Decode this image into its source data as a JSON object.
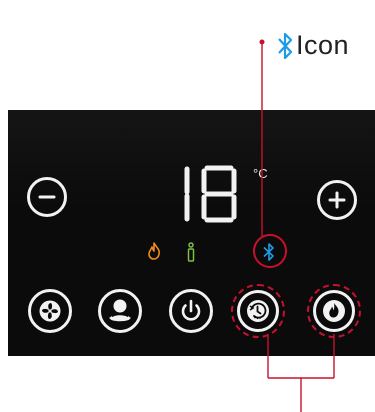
{
  "callout": {
    "label": "Icon",
    "icon": "bluetooth-icon",
    "accent": "#1e9be8"
  },
  "display": {
    "temperature": "18",
    "unit": "°C"
  },
  "controls": {
    "decrease": "minus-icon",
    "increase": "plus-icon",
    "bottom_row": [
      "fan-icon",
      "person-icon",
      "power-icon",
      "timer-icon",
      "flame-icon"
    ]
  },
  "indicators": [
    "flame-indicator-icon",
    "info-indicator-icon",
    "bluetooth-indicator-icon"
  ],
  "colors": {
    "panel": "#0b0b0b",
    "outline": "#f2f2f2",
    "annotation": "#c8102e",
    "flame": "#f08a1c",
    "info": "#7ac142",
    "bluetooth": "#1e9be8"
  }
}
